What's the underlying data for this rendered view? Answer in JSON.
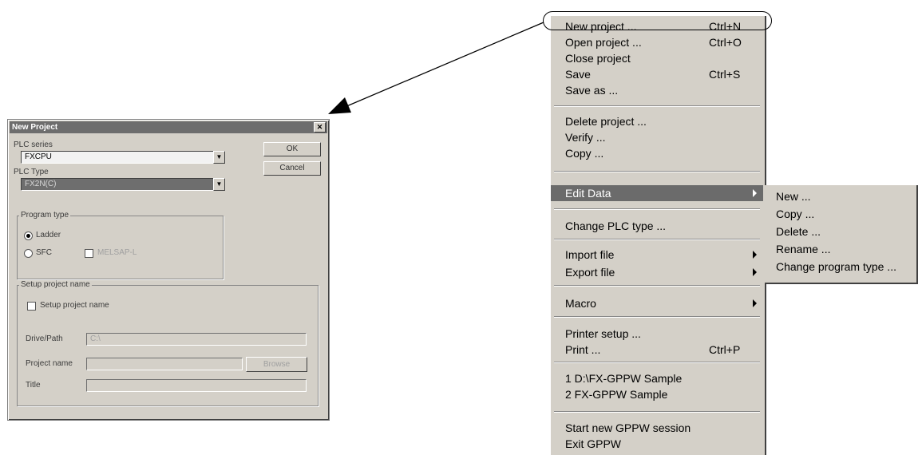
{
  "dialog": {
    "title": "New Project",
    "close_glyph": "✕",
    "plc_series_label": "PLC series",
    "plc_series_value": "FXCPU",
    "plc_type_label": "PLC Type",
    "plc_type_value": "FX2N(C)",
    "ok_label": "OK",
    "cancel_label": "Cancel",
    "program_type": {
      "title": "Program type",
      "ladder_label": "Ladder",
      "sfc_label": "SFC",
      "melsap_label": "MELSAP-L"
    },
    "setup": {
      "title": "Setup project name",
      "checkbox_label": "Setup project name",
      "drive_path_label": "Drive/Path",
      "drive_path_value": "C:\\",
      "project_name_label": "Project name",
      "browse_label": "Browse",
      "title_label": "Title"
    }
  },
  "menu": {
    "items": [
      {
        "label": "New project ...",
        "shortcut": "Ctrl+N"
      },
      {
        "label": "Open project ...",
        "shortcut": "Ctrl+O"
      },
      {
        "label": "Close project",
        "shortcut": ""
      },
      {
        "label": "Save",
        "shortcut": "Ctrl+S"
      },
      {
        "label": "Save as ...",
        "shortcut": ""
      },
      {
        "label": "Delete project ...",
        "shortcut": ""
      },
      {
        "label": "Verify ...",
        "shortcut": ""
      },
      {
        "label": "Copy ...",
        "shortcut": ""
      },
      {
        "label": "Edit Data",
        "shortcut": ""
      },
      {
        "label": "Change PLC type ...",
        "shortcut": ""
      },
      {
        "label": "Import file",
        "shortcut": ""
      },
      {
        "label": "Export file",
        "shortcut": ""
      },
      {
        "label": "Macro",
        "shortcut": ""
      },
      {
        "label": "Printer setup ...",
        "shortcut": ""
      },
      {
        "label": "Print ...",
        "shortcut": "Ctrl+P"
      },
      {
        "label": "1 D:\\FX-GPPW Sample",
        "shortcut": ""
      },
      {
        "label": "2 FX-GPPW Sample",
        "shortcut": ""
      },
      {
        "label": "Start new GPPW session",
        "shortcut": ""
      },
      {
        "label": "Exit GPPW",
        "shortcut": ""
      }
    ]
  },
  "submenu": {
    "items": [
      {
        "label": "New ..."
      },
      {
        "label": "Copy ..."
      },
      {
        "label": "Delete ..."
      },
      {
        "label": "Rename ..."
      },
      {
        "label": "Change program type ..."
      }
    ]
  },
  "colors": {
    "dialog_bg": "#d4d0c8",
    "highlight": "#6b6b6b",
    "titlebar": "#6d6d6d"
  }
}
